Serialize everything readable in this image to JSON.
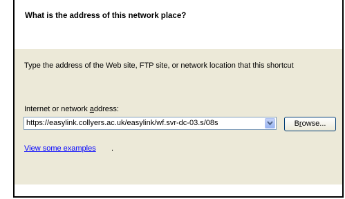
{
  "header": {
    "title": "What is the address of this network place?"
  },
  "content": {
    "instruction": "Type the address of the Web site, FTP site, or network location that this shortcut",
    "field_label_before": "Internet or network ",
    "field_label_accel": "a",
    "field_label_after": "ddress:",
    "address_value": "https://easylink.collyers.ac.uk/easylink/wf.svr-dc-03.s/08s",
    "browse_label_accel": "r",
    "browse_label_before": "B",
    "browse_label_after": "owse...",
    "examples_link": "View some examples",
    "examples_period": "."
  },
  "icons": {
    "dropdown": "chevron-down-icon"
  },
  "colors": {
    "panel_bg": "#ece9d8",
    "link": "#0000ff",
    "combo_border": "#7f9db9",
    "button_border": "#003c74"
  }
}
